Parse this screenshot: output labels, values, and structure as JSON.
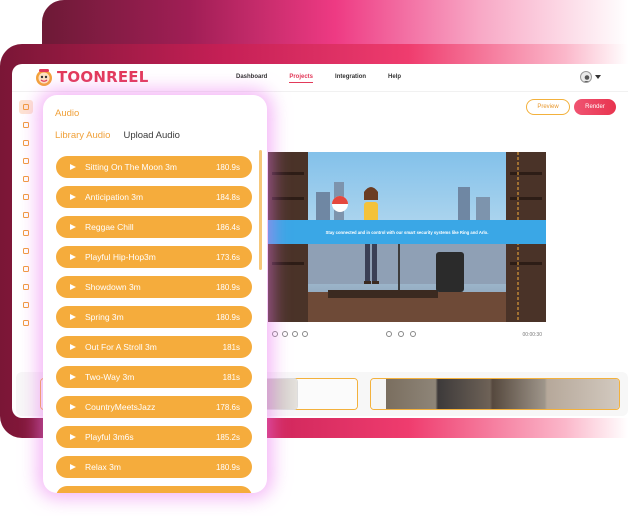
{
  "app": {
    "logo_text": "TOONREEL",
    "nav": [
      "Dashboard",
      "Projects",
      "Integration",
      "Help"
    ],
    "active_nav": "Projects",
    "preview_label": "Preview",
    "render_label": "Render",
    "sidebar_icons": [
      "layout-icon",
      "text-icon",
      "media-icon",
      "image-icon",
      "group-icon",
      "edit-icon",
      "wand-icon",
      "character-icon",
      "link-icon",
      "tag-icon",
      "grid-icon",
      "settings-icon",
      "layers-icon"
    ]
  },
  "canvas": {
    "caption": "Stay connected and in control with our smart security systems like Ring and Arlo.",
    "time": "00:00:30"
  },
  "audio_panel": {
    "title": "Audio",
    "tabs": [
      "Library Audio",
      "Upload Audio"
    ],
    "active_tab": "Library Audio",
    "tracks": [
      {
        "name": "Sitting On The Moon 3m",
        "duration": "180.9s"
      },
      {
        "name": "Anticipation 3m",
        "duration": "184.8s"
      },
      {
        "name": "Reggae Chill",
        "duration": "186.4s"
      },
      {
        "name": "Playful Hip-Hop3m",
        "duration": "173.6s"
      },
      {
        "name": "Showdown 3m",
        "duration": "180.9s"
      },
      {
        "name": "Spring 3m",
        "duration": "180.9s"
      },
      {
        "name": "Out For A Stroll 3m",
        "duration": "181s"
      },
      {
        "name": "Two-Way 3m",
        "duration": "181s"
      },
      {
        "name": "CountryMeetsJazz",
        "duration": "178.6s"
      },
      {
        "name": "Playful 3m6s",
        "duration": "185.2s"
      },
      {
        "name": "Relax 3m",
        "duration": "180.9s"
      }
    ]
  },
  "colors": {
    "accent_orange": "#f5ac3c",
    "brand_red": "#e23a5a",
    "caption_blue": "#3aa7e6"
  }
}
